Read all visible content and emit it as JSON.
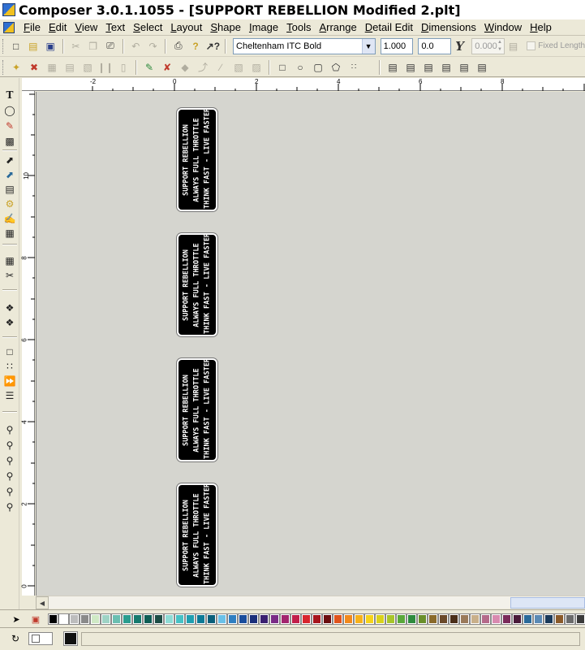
{
  "window": {
    "title": "Composer 3.0.1.1055 - [SUPPORT REBELLION Modified 2.plt]"
  },
  "menu": [
    "File",
    "Edit",
    "View",
    "Text",
    "Select",
    "Layout",
    "Shape",
    "Image",
    "Tools",
    "Arrange",
    "Detail Edit",
    "Dimensions",
    "Window",
    "Help"
  ],
  "toolbar": {
    "font_name": "Cheltenham ITC Bold",
    "font_size": "1.000",
    "slant": "0.0",
    "slant_icon": "italic-y-icon",
    "fixed_length_value": "0.000",
    "fixed_length_label": "Fixed Length"
  },
  "rulers": {
    "horizontal": [
      "-2",
      "0",
      "2",
      "4",
      "6",
      "8"
    ],
    "vertical": [
      "10",
      "8",
      "6",
      "4",
      "2",
      "0"
    ]
  },
  "plates": [
    {
      "lines": [
        "SUPPORT REBELLION",
        "ALWAYS FULL THROTTLE",
        "THINK FAST - LIVE FASTER"
      ]
    },
    {
      "lines": [
        "SUPPORT REBELLION",
        "ALWAYS FULL THROTTLE",
        "THINK FAST - LIVE FASTER"
      ]
    },
    {
      "lines": [
        "SUPPORT REBELLION",
        "ALWAYS FULL THROTTLE",
        "THINK FAST - LIVE FASTER"
      ]
    },
    {
      "lines": [
        "SUPPORT REBELLION",
        "ALWAYS FULL THROTTLE",
        "THINK FAST - LIVE FASTER"
      ]
    }
  ],
  "palette": {
    "colors": [
      "#000000",
      "#ffffff",
      "#bdbdbd",
      "#8a8a8a",
      "#cfe9c5",
      "#9ed3c5",
      "#6bbfb1",
      "#2a9d8f",
      "#167a6e",
      "#0e5e55",
      "#1c4d45",
      "#8edcd5",
      "#47c2c5",
      "#1f9fb0",
      "#0c7a96",
      "#0a5f7a",
      "#6ac1e8",
      "#2f7fc1",
      "#1a4e9c",
      "#1a2f7a",
      "#3a1f70",
      "#7a2b86",
      "#a3256e",
      "#c21f4a",
      "#d8262e",
      "#a8161d",
      "#6b0d0f",
      "#e0541c",
      "#f28a1c",
      "#f7b21a",
      "#f6d31a",
      "#d9d21b",
      "#a8c52a",
      "#5aa83a",
      "#2e8b3d",
      "#6a8f2a",
      "#8a6a2a",
      "#6b4a2a",
      "#4a2e18",
      "#9a7a5a",
      "#c9b08a",
      "#b56a8a",
      "#d98ab0",
      "#7a2a5a",
      "#4a1a3a",
      "#2a6a9a",
      "#5a8ab5",
      "#1a3a5a",
      "#8a5a2a",
      "#6a6a6a",
      "#3a3a3a"
    ]
  },
  "status": {
    "fill_color": "#ffffff",
    "stroke_color": "#111111"
  }
}
